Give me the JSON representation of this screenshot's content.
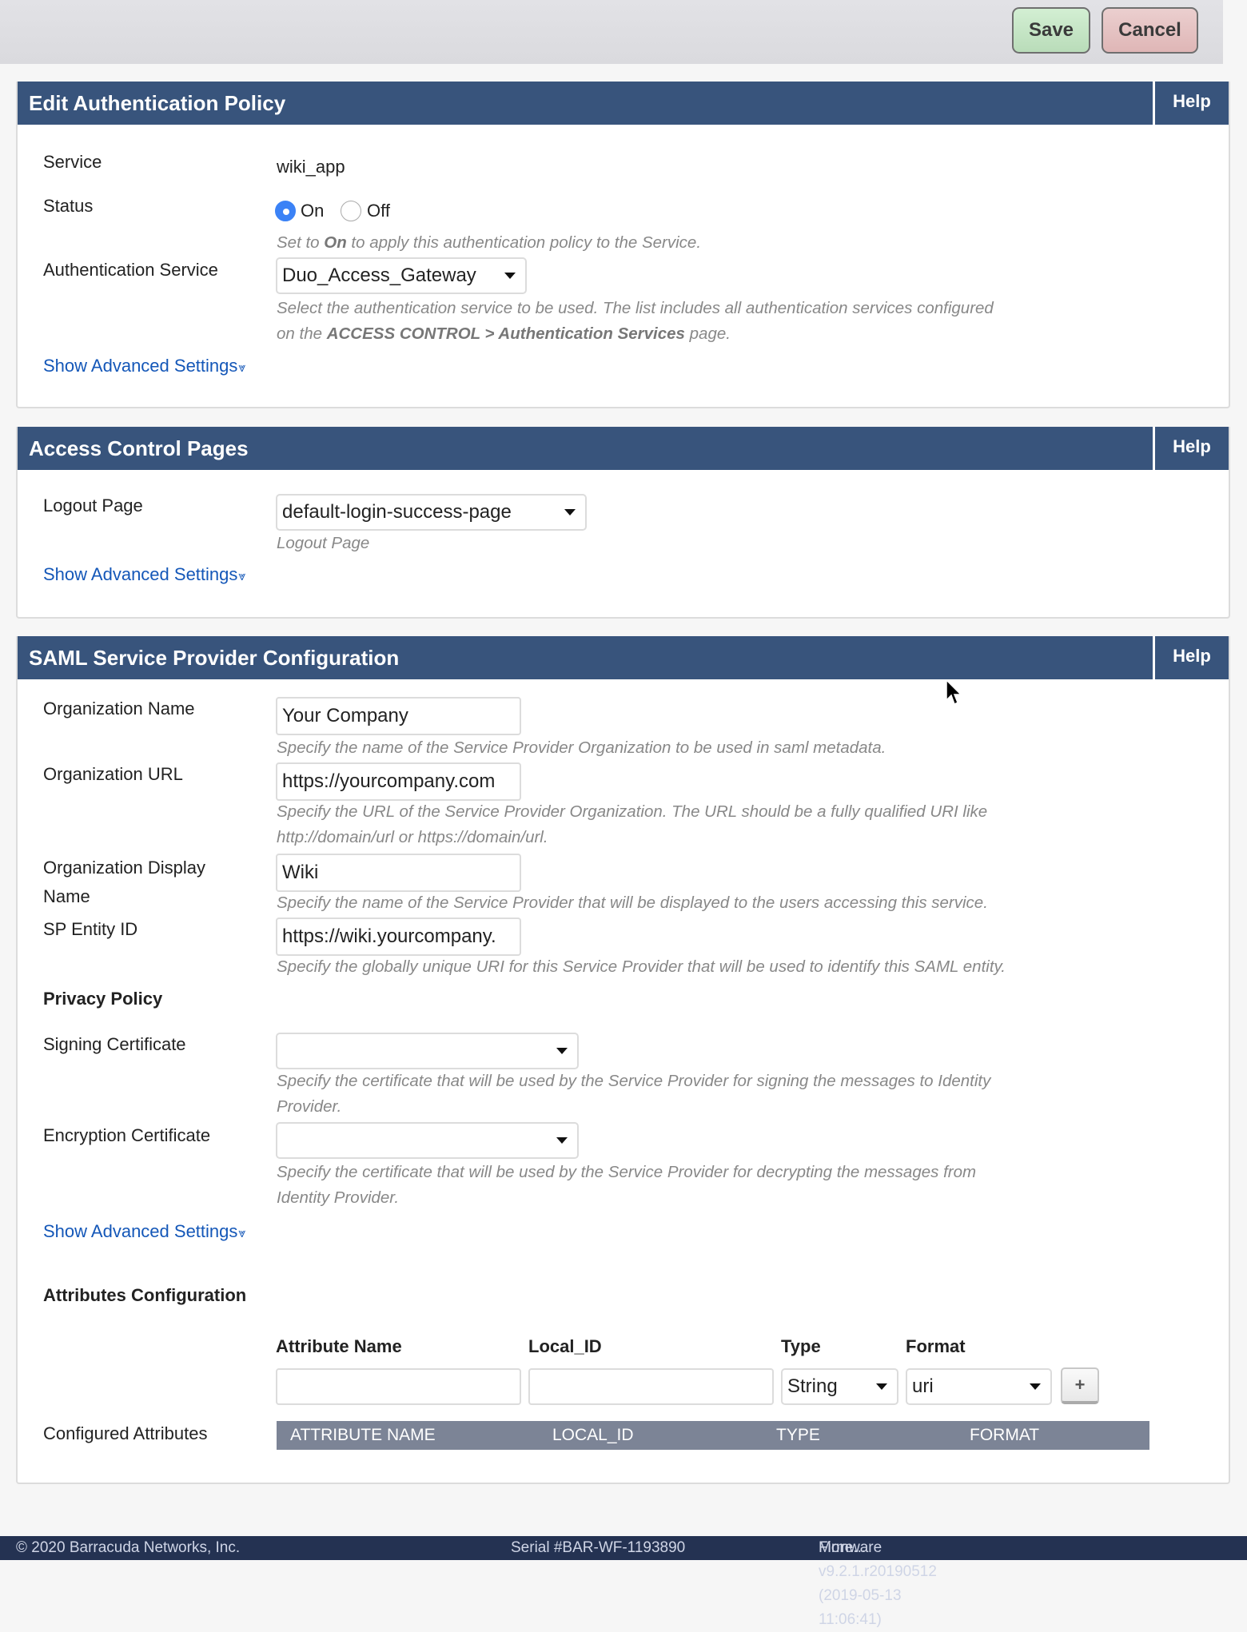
{
  "toolbar": {
    "save_label": "Save",
    "cancel_label": "Cancel"
  },
  "panels": {
    "auth_policy": {
      "title": "Edit Authentication Policy",
      "help_label": "Help",
      "service": {
        "label": "Service",
        "value": "wiki_app"
      },
      "status": {
        "label": "Status",
        "options": [
          {
            "label": "On",
            "selected": true
          },
          {
            "label": "Off",
            "selected": false
          }
        ],
        "hint_prefix": "Set to ",
        "hint_bold": "On",
        "hint_suffix": " to apply this authentication policy to the Service."
      },
      "auth_service": {
        "label": "Authentication Service",
        "value": "Duo_Access_Gateway",
        "hint_line1": "Select the authentication service to be used. The list includes all authentication services configured",
        "hint_line2_prefix": "on the ",
        "hint_line2_bold": "ACCESS CONTROL > Authentication Services",
        "hint_line2_suffix": " page."
      },
      "advanced_link": "Show Advanced Settings"
    },
    "access_control": {
      "title": "Access Control Pages",
      "help_label": "Help",
      "logout_page": {
        "label": "Logout Page",
        "value": "default-login-success-page",
        "hint": "Logout Page"
      },
      "advanced_link": "Show Advanced Settings"
    },
    "saml": {
      "title": "SAML Service Provider Configuration",
      "help_label": "Help",
      "org_name": {
        "label": "Organization Name",
        "value": "Your Company",
        "hint": "Specify the name of the Service Provider Organization to be used in saml metadata."
      },
      "org_url": {
        "label": "Organization URL",
        "value": "https://yourcompany.com",
        "hint_line1": "Specify the URL of the Service Provider Organization. The URL should be a fully qualified URI like",
        "hint_line2": "http://domain/url or https://domain/url."
      },
      "org_display": {
        "label_line1": "Organization Display",
        "label_line2": "Name",
        "value": "Wiki",
        "hint": "Specify the name of the Service Provider that will be displayed to the users accessing this service."
      },
      "sp_entity": {
        "label": "SP Entity ID",
        "value": "https://wiki.yourcompany.",
        "hint": "Specify the globally unique URI for this Service Provider that will be used to identify this SAML entity."
      },
      "privacy_policy_heading": "Privacy Policy",
      "signing_cert": {
        "label": "Signing Certificate",
        "value": "",
        "hint_line1": "Specify the certificate that will be used by the Service Provider for signing the messages to Identity",
        "hint_line2": "Provider."
      },
      "encryption_cert": {
        "label": "Encryption Certificate",
        "value": "",
        "hint_line1": "Specify the certificate that will be used by the Service Provider for decrypting the messages from",
        "hint_line2": "Identity Provider."
      },
      "advanced_link": "Show Advanced Settings",
      "attributes": {
        "heading": "Attributes Configuration",
        "columns": [
          "Attribute Name",
          "Local_ID",
          "Type",
          "Format"
        ],
        "attribute_name_value": "",
        "local_id_value": "",
        "type_value": "String",
        "format_value": "uri",
        "add_label": "+",
        "configured_label": "Configured Attributes",
        "table_headers": [
          "ATTRIBUTE NAME",
          "LOCAL_ID",
          "TYPE",
          "FORMAT"
        ]
      }
    }
  },
  "footer": {
    "copyright": "© 2020 Barracuda Networks, Inc.",
    "serial": "Serial #BAR-WF-1193890",
    "firmware": "Firmware v9.2.1.r20190512 (2019-05-13 11:06:41)",
    "more_link": "More..."
  },
  "colors": {
    "header_bg": "#38547c",
    "link": "#1457b8",
    "footer_bg": "#243252",
    "table_head_bg": "#7c8496"
  }
}
